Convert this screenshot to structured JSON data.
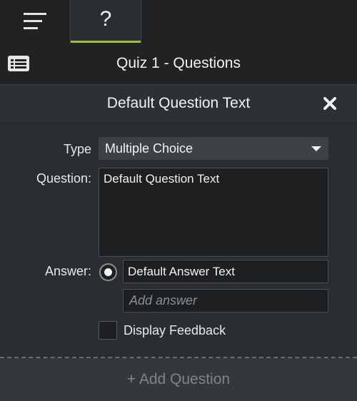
{
  "tabs": {
    "menu_icon": "menu-icon",
    "help_label": "?"
  },
  "header": {
    "icon": "list-panel-icon",
    "title": "Quiz 1 - Questions"
  },
  "question_panel": {
    "title": "Default Question Text",
    "close_icon": "close-icon"
  },
  "form": {
    "type_label": "Type",
    "type_value": "Multiple Choice",
    "question_label": "Question:",
    "question_value": "Default Question Text",
    "answer_label": "Answer:",
    "answers": [
      {
        "text": "Default Answer Text",
        "selected": true
      }
    ],
    "add_answer_placeholder": "Add answer",
    "display_feedback_label": "Display Feedback",
    "display_feedback_checked": false
  },
  "footer": {
    "add_question_label": "+ Add Question"
  },
  "colors": {
    "accent": "#9bc33a",
    "background": "#2b2e31",
    "header_bg": "#202224"
  }
}
